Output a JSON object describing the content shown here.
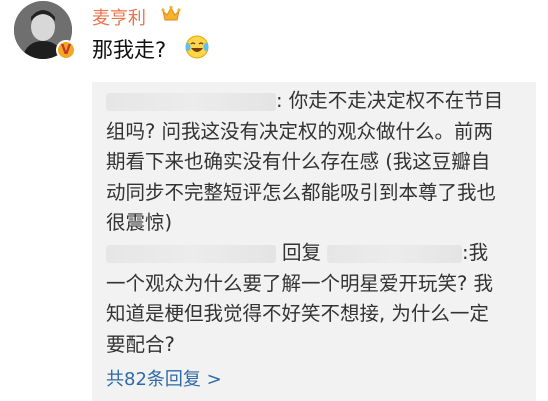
{
  "user": {
    "name": "麦亨利",
    "avatar_icon": "portrait-avatar",
    "verified_icon": "verified-v-badge-icon",
    "crown_icon": "crown-icon"
  },
  "comment": {
    "text": "那我走?",
    "emoji_icon": "laughing-tears-emoji"
  },
  "replies": [
    {
      "author": "",
      "text": ": 你走不走决定权不在节目组吗? 问我这没有决定权的观众做什么。前两期看下来也确实没有什么存在感 (我这豆瓣自动同步不完整短评怎么都能吸引到本尊了我也很震惊)"
    },
    {
      "author": "",
      "reply_word": "回复",
      "target": "",
      "text": ":我一个观众为什么要了解一个明星爱开玩笑? 我知道是梗但我觉得不好笑不想接, 为什么一定要配合?"
    }
  ],
  "more_replies": "共82条回复 >",
  "colors": {
    "username": "#eb7350",
    "link": "#2f6aa8",
    "reply_bg": "#f2f2f2"
  }
}
